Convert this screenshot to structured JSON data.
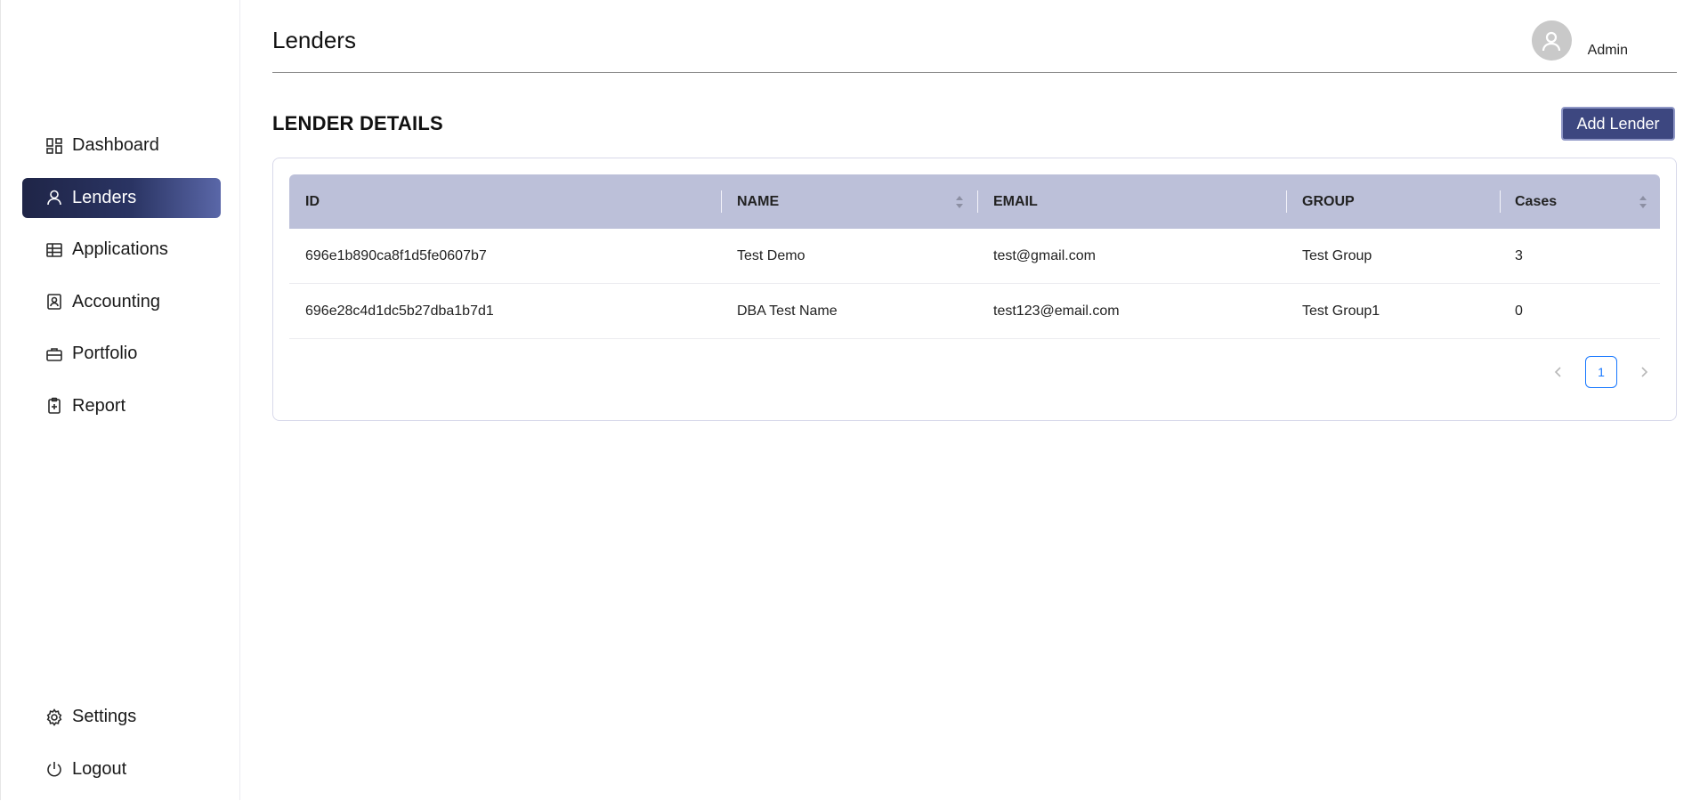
{
  "sidebar": {
    "items": [
      {
        "label": "Dashboard",
        "icon": "dashboard-icon"
      },
      {
        "label": "Lenders",
        "icon": "user-icon",
        "active": true
      },
      {
        "label": "Applications",
        "icon": "table-icon"
      },
      {
        "label": "Accounting",
        "icon": "contact-book-icon"
      },
      {
        "label": "Portfolio",
        "icon": "briefcase-icon"
      },
      {
        "label": "Report",
        "icon": "clipboard-plus-icon"
      }
    ],
    "bottom_items": [
      {
        "label": "Settings",
        "icon": "gear-icon"
      },
      {
        "label": "Logout",
        "icon": "power-icon"
      }
    ],
    "active_color": "#2a3463"
  },
  "header": {
    "title": "Lenders",
    "user_name": "Admin"
  },
  "section": {
    "title": "LENDER DETAILS",
    "add_button_label": "Add Lender"
  },
  "table": {
    "columns": [
      "ID",
      "NAME",
      "EMAIL",
      "GROUP",
      "Cases"
    ],
    "rows": [
      {
        "id": "696e1b890ca8f1d5fe0607b7",
        "name": "Test Demo",
        "email": "test@gmail.com",
        "group": "Test Group",
        "cases": "3"
      },
      {
        "id": "696e28c4d1dc5b27dba1b7d1",
        "name": "DBA Test Name",
        "email": "test123@email.com",
        "group": "Test Group1",
        "cases": "0"
      }
    ],
    "header_color": "#bcc0d9"
  },
  "pagination": {
    "current_page": "1",
    "accent_color": "#1677ff"
  }
}
